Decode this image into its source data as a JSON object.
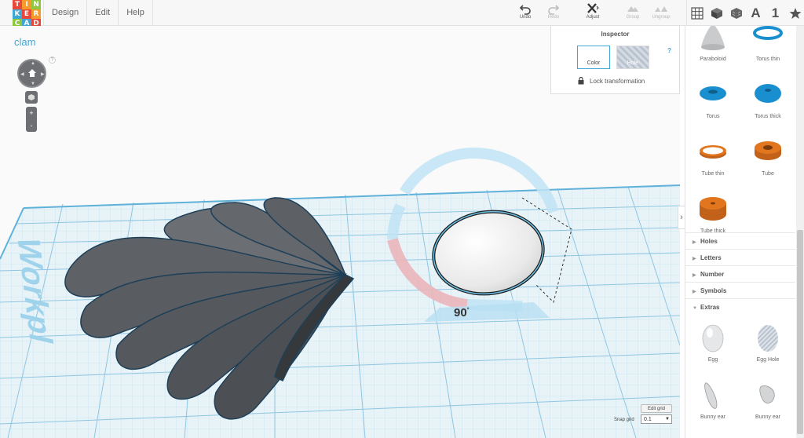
{
  "logo": {
    "letters": [
      "T",
      "I",
      "N",
      "K",
      "E",
      "R",
      "C",
      "A",
      "D"
    ],
    "colors": [
      "#e8473c",
      "#f59a2b",
      "#8ec63f",
      "#3fa6d6",
      "#e8473c",
      "#f59a2b",
      "#8ec63f",
      "#3fa6d6",
      "#e8473c"
    ]
  },
  "menu": {
    "items": [
      "Design",
      "Edit",
      "Help"
    ]
  },
  "toolbar": {
    "undo": "Undo",
    "redo": "Redo",
    "adjust": "Adjust",
    "group": "Group",
    "ungroup": "Ungroup"
  },
  "view": {
    "letters_label": "A",
    "numbers_label": "1"
  },
  "project": {
    "name": "clam"
  },
  "help_mark": "?",
  "navigation": {
    "zoom_in": "+",
    "zoom_out": "-"
  },
  "inspector": {
    "title": "Inspector",
    "help": "?",
    "color_label": "Color",
    "hole_label": "Hole",
    "lock_label": "Lock transformation"
  },
  "workplane": {
    "text": "Workpl",
    "rotation_value": "90",
    "rotation_unit": "°"
  },
  "grid": {
    "edit_label": "Edit grid",
    "snap_label": "Snap grid",
    "snap_value": "0.1"
  },
  "sidebar": {
    "shapes_top": [
      {
        "label": "Paraboloid",
        "icon": "paraboloid-icon"
      },
      {
        "label": "Torus thin",
        "icon": "torus-thin-icon"
      },
      {
        "label": "Torus",
        "icon": "torus-icon"
      },
      {
        "label": "Torus thick",
        "icon": "torus-thick-icon"
      },
      {
        "label": "Tube thin",
        "icon": "tube-thin-icon"
      },
      {
        "label": "Tube",
        "icon": "tube-icon"
      },
      {
        "label": "Tube thick",
        "icon": "tube-thick-icon"
      }
    ],
    "categories": [
      "Holes",
      "Letters",
      "Number",
      "Symbols",
      "Extras"
    ],
    "extras": [
      {
        "label": "Egg",
        "icon": "egg-icon"
      },
      {
        "label": "Egg Hole",
        "icon": "egg-hole-icon"
      },
      {
        "label": "Bunny ear",
        "icon": "bunny-ear-icon"
      },
      {
        "label": "Bunny ear",
        "icon": "bunny-ear-hole-icon"
      }
    ]
  },
  "colors": {
    "accent": "#3fa6d6",
    "shape_orange": "#e2761e",
    "shape_blue": "#1a8fd0",
    "clam_gray": "#5e6266"
  }
}
